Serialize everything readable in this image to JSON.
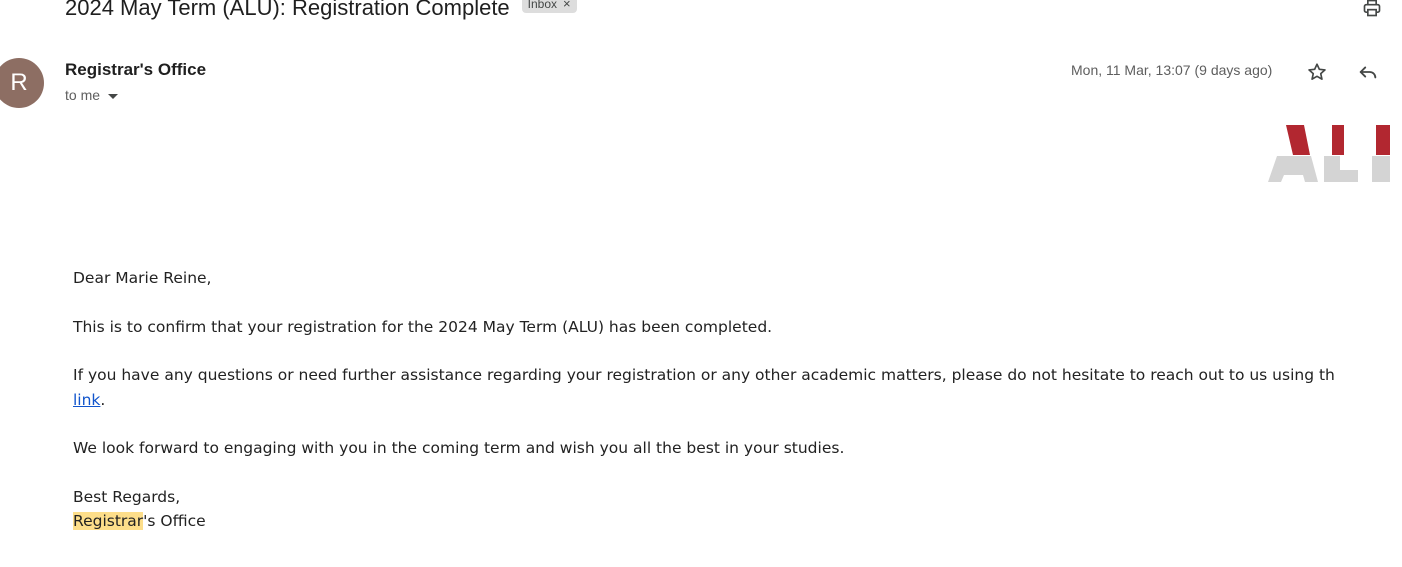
{
  "email": {
    "subject": "2024 May Term (ALU): Registration Complete",
    "label": "Inbox",
    "label_close": "×",
    "sender_initial": "R",
    "sender_name": "Registrar's Office",
    "recipient": "to me",
    "date": "Mon, 11 Mar, 13:07 (9 days ago)",
    "icons": {
      "print": "print-icon",
      "star": "star-icon",
      "reply": "reply-icon"
    },
    "colors": {
      "avatar": "#8d6e63",
      "logo_red": "#b22730",
      "logo_gray": "#d4d4d4",
      "highlight": "#fdde8a",
      "link": "#1155cc"
    }
  },
  "body": {
    "greeting": "Dear Marie Reine,",
    "confirmation": "This is to confirm that your registration for the 2024 May Term (ALU) has been completed.",
    "questions_text": "If you have any questions or need further assistance regarding your registration or any other academic matters, please do not hesitate to reach out to us using th",
    "link_text": "link",
    "link_suffix": ".",
    "closing_line": "We look forward to engaging with you in the coming term and wish you all the best in your studies.",
    "regards": "Best Regards,",
    "signature_highlight": "Registrar",
    "signature_rest": "'s Office"
  }
}
